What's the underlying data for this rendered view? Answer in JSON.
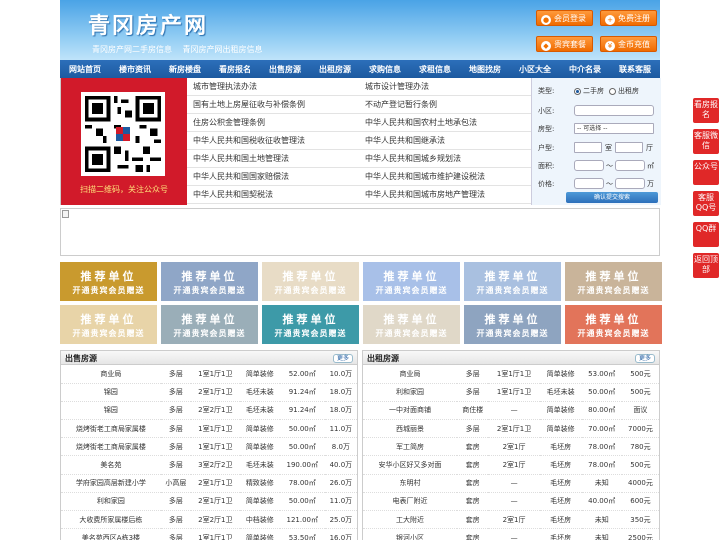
{
  "header": {
    "title": "青冈房产网",
    "subtitle_1": "青冈房产网二手房信息",
    "subtitle_2": "青冈房产网出租房信息",
    "buttons": [
      "会员登录",
      "免费注册",
      "贵宾套餐",
      "金币充值"
    ]
  },
  "nav": [
    "网站首页",
    "楼市资讯",
    "新房楼盘",
    "看房报名",
    "出售房源",
    "出租房源",
    "求购信息",
    "求租信息",
    "地图找房",
    "小区大全",
    "中介名录",
    "联系客服"
  ],
  "qr": {
    "caption": "扫描二维码，关注公众号"
  },
  "links": [
    [
      "城市管理执法办法",
      "城市设计管理办法"
    ],
    [
      "国有土地上房屋征收与补偿条例",
      "不动产登记暂行条例"
    ],
    [
      "住房公积金管理条例",
      "中华人民共和国农村土地承包法"
    ],
    [
      "中华人民共和国税收征收管理法",
      "中华人民共和国继承法"
    ],
    [
      "中华人民共和国土地管理法",
      "中华人民共和国城乡规划法"
    ],
    [
      "中华人民共和国国家赔偿法",
      "中华人民共和国城市维护建设税法"
    ],
    [
      "中华人民共和国契税法",
      "中华人民共和国城市房地产管理法"
    ]
  ],
  "search": {
    "type_label": "类型:",
    "opt1": "二手房",
    "opt2": "出租房",
    "community_label": "小区:",
    "room_label": "房型:",
    "room_select": "-- 可选择 --",
    "layout_label": "户型:",
    "shi": "室",
    "ting": "厅",
    "area_label": "面积:",
    "area_unit": "㎡",
    "price_label": "价格:",
    "price_unit": "万",
    "tilde": "～",
    "submit": "确认提交搜索"
  },
  "ads": {
    "t1": "推荐单位",
    "t2": "开通贵宾会员赠送",
    "colors": [
      "#c99a2e",
      "#8fa6c7",
      "#e8dcc6",
      "#a8c0e8",
      "#a9c0e0",
      "#c9b49a",
      "#e8d4a8",
      "#9aaeb8",
      "#3d9aa8",
      "#e0d8c8",
      "#8ea4c0",
      "#e2745a"
    ]
  },
  "sale": {
    "title": "出售房源",
    "more": "更多",
    "rows": [
      [
        "商业局",
        "多层",
        "1室1厅1卫",
        "简单装修",
        "52.00㎡",
        "10.0万"
      ],
      [
        "锦园",
        "多层",
        "2室1厅1卫",
        "毛坯未装",
        "91.24㎡",
        "18.0万"
      ],
      [
        "锦园",
        "多层",
        "2室2厅1卫",
        "毛坯未装",
        "91.24㎡",
        "18.0万"
      ],
      [
        "烧烤街老工商局家属楼",
        "多层",
        "1室1厅1卫",
        "简单装修",
        "50.00㎡",
        "11.0万"
      ],
      [
        "烧烤街老工商局家属楼",
        "多层",
        "1室1厅1卫",
        "简单装修",
        "50.00㎡",
        "8.0万"
      ],
      [
        "美名苑",
        "多层",
        "3室2厅2卫",
        "毛坯未装",
        "190.00㎡",
        "40.0万"
      ],
      [
        "学府家园高层新建小学",
        "小高层",
        "2室1厅1卫",
        "精致装修",
        "78.00㎡",
        "26.0万"
      ],
      [
        "利和家园",
        "多层",
        "2室1厅1卫",
        "简单装修",
        "50.00㎡",
        "11.0万"
      ],
      [
        "大收费所家属楼后栋",
        "多层",
        "2室2厅1卫",
        "中档装修",
        "121.00㎡",
        "25.0万"
      ],
      [
        "美名苑西区A栋3楼",
        "多层",
        "1室1厅1卫",
        "简单装修",
        "53.50㎡",
        "16.0万"
      ]
    ]
  },
  "rent": {
    "title": "出租房源",
    "more": "更多",
    "rows": [
      [
        "商业局",
        "多层",
        "1室1厅1卫",
        "简单装修",
        "53.00㎡",
        "500元"
      ],
      [
        "利和家园",
        "多层",
        "1室1厅1卫",
        "毛坯未装",
        "50.00㎡",
        "500元"
      ],
      [
        "一中对面商铺",
        "商住楼",
        "—",
        "简单装修",
        "80.00㎡",
        "面议"
      ],
      [
        "西城丽景",
        "多层",
        "2室1厅1卫",
        "简单装修",
        "70.00㎡",
        "7000元"
      ],
      [
        "军工简房",
        "套房",
        "2室1厅",
        "毛坯房",
        "78.00㎡",
        "780元"
      ],
      [
        "安华小区好又多对面",
        "套房",
        "2室1厅",
        "毛坯房",
        "78.00㎡",
        "500元"
      ],
      [
        "东明村",
        "套房",
        "—",
        "毛坯房",
        "未知",
        "4000元"
      ],
      [
        "电表厂附近",
        "套房",
        "—",
        "毛坯房",
        "40.00㎡",
        "600元"
      ],
      [
        "工大附近",
        "套房",
        "2室1厅",
        "毛坯房",
        "未知",
        "350元"
      ],
      [
        "银河小区",
        "套房",
        "—",
        "毛坯房",
        "未知",
        "2500元"
      ]
    ]
  },
  "side": [
    "看房报名",
    "客服微信",
    "公众号",
    "客服QQ号",
    "QQ群",
    "返回顶部"
  ]
}
